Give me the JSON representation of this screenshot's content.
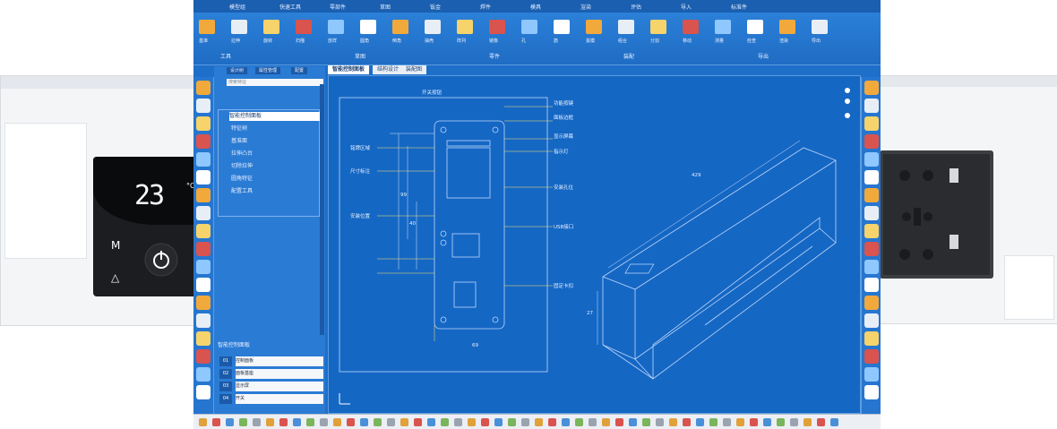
{
  "left_background": {
    "thermostat": {
      "temperature": "23",
      "unit": "°C",
      "mode_label": "M"
    }
  },
  "window": {
    "topbar_items": [
      "模型组",
      "快速工具",
      "零部件",
      "草图",
      "钣金",
      "焊件",
      "模具",
      "渲染",
      "评估",
      "导入",
      "标准件"
    ],
    "ribbon": {
      "group_labels": [
        "工具",
        "草图",
        "零件",
        "装配",
        "导出"
      ],
      "button_labels": [
        "基准",
        "拉伸",
        "旋转",
        "扫描",
        "放样",
        "圆角",
        "倒角",
        "抽壳",
        "阵列",
        "镜像",
        "孔",
        "筋",
        "拔模",
        "组合",
        "分割",
        "移动",
        "测量",
        "检查",
        "渲染",
        "导出"
      ]
    },
    "tree": {
      "tabs": [
        "设计树",
        "属性管理",
        "配置"
      ],
      "search_placeholder": "搜索特征",
      "root": "智能控制面板",
      "items": [
        "特征树",
        "基准面",
        "拉伸凸台",
        "切除拉伸",
        "圆角特征",
        "配置工具"
      ],
      "bottom_title": "智能控制面板",
      "bottom_rows": [
        "控制面板",
        "面板基座",
        "显示屏",
        "开关"
      ]
    },
    "doc_tabs": [
      "智能控制面板",
      "结构设计",
      "装配图"
    ],
    "callouts": [
      "开关按钮",
      "功能按键",
      "面板边框",
      "显示屏幕",
      "指示灯",
      "安装孔位",
      "USB接口",
      "固定卡扣",
      "铭牌区域",
      "尺寸标注",
      "安装位置"
    ],
    "dimension_values": [
      "429",
      "27",
      "99",
      "40",
      "69"
    ]
  }
}
